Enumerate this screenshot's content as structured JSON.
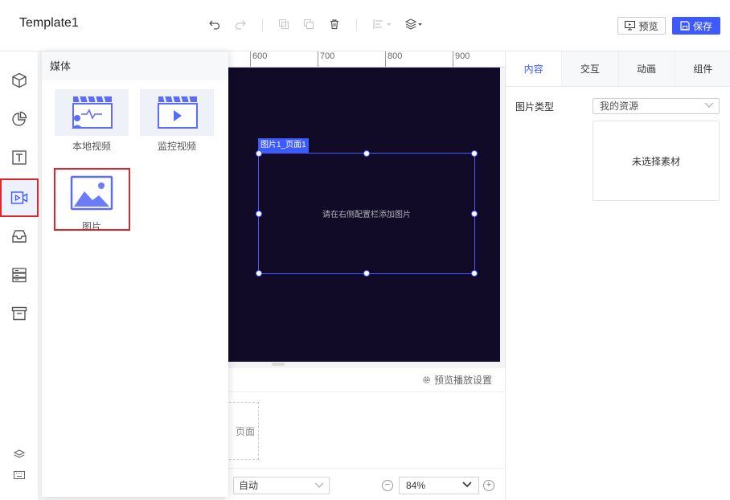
{
  "header": {
    "title": "Template1",
    "preview_label": "预览",
    "save_label": "保存",
    "tools": [
      "undo-icon",
      "redo-icon",
      "copy-icon",
      "paste-icon",
      "trash-icon",
      "align-icon",
      "layers-icon"
    ]
  },
  "rail": {
    "items": [
      "cube-icon",
      "pie-chart-icon",
      "text-icon",
      "video-icon",
      "inbox-icon",
      "server-icon",
      "archive-icon"
    ],
    "active": "video-icon",
    "bottom": [
      "stack-icon",
      "keyboard-icon"
    ]
  },
  "media_panel": {
    "title": "媒体",
    "items": [
      {
        "label": "本地视频",
        "icon": "local-video-icon"
      },
      {
        "label": "监控视频",
        "icon": "surveillance-video-icon"
      },
      {
        "label": "图片",
        "icon": "image-icon"
      }
    ]
  },
  "ruler": {
    "labels": [
      "600",
      "700",
      "800",
      "900"
    ]
  },
  "canvas": {
    "selection_tag": "图片1_页面1",
    "hint": "请在右侧配置栏添加图片",
    "background": "#110b27",
    "accent": "#3d5afe"
  },
  "bottom": {
    "preview_settings": "预览播放设置",
    "page_label": "页面",
    "auto_select": "自动",
    "zoom": "84%"
  },
  "right_panel": {
    "tabs": [
      "内容",
      "交互",
      "动画",
      "组件"
    ],
    "active_tab": "内容",
    "image_type_label": "图片类型",
    "image_type_value": "我的资源",
    "empty_asset": "未选择素材"
  }
}
